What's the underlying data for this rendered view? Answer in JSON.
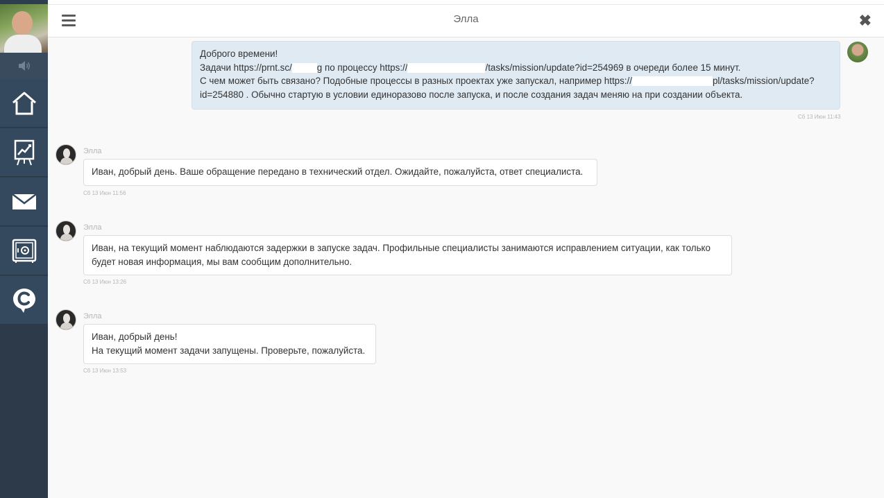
{
  "header": {
    "title": "Элла",
    "menu_icon": "hamburger-icon",
    "close_icon": "close-icon",
    "close_glyph": "✖"
  },
  "sidebar": {
    "items": [
      {
        "icon": "sound-icon"
      },
      {
        "icon": "home-icon"
      },
      {
        "icon": "chart-board-icon"
      },
      {
        "icon": "mail-icon"
      },
      {
        "icon": "safe-icon"
      },
      {
        "icon": "chat-logo-icon"
      }
    ],
    "colors": {
      "background": "#2f3e4e",
      "item": "#34495e"
    }
  },
  "messages": [
    {
      "direction": "out",
      "lines": [
        "Доброго времени!",
        "Задачи https://prnt.sc/",
        "g по процессу https://",
        "/tasks/mission/update?id=254969 в очереди более 15 минут.",
        "С чем может быть связано? Подобные процессы в разных проектах уже запускал, например https://",
        "pl/tasks/mission/update?",
        "id=254880 . Обычно стартую в условии единоразово после запуска, и после создания задач меняю на при создании объекта."
      ],
      "time": "Сб 13 Июн 11:43"
    },
    {
      "direction": "in",
      "sender": "Элла",
      "lines": [
        "Иван, добрый день. Ваше обращение передано в технический отдел. Ожидайте, пожалуйста, ответ специалиста."
      ],
      "time": "Сб 13 Июн 11:56"
    },
    {
      "direction": "in",
      "sender": "Элла",
      "lines": [
        "Иван, на текущий момент наблюдаются задержки в запуске задач. Профильные специалисты занимаются исправлением ситуации, как только",
        "будет новая информация, мы вам сообщим дополнительно."
      ],
      "time": "Сб 13 Июн 13:26"
    },
    {
      "direction": "in",
      "sender": "Элла",
      "lines": [
        "Иван, добрый день!",
        "На текущий момент задачи запущены. Проверьте, пожалуйста."
      ],
      "time": "Сб 13 Июн 13:53"
    }
  ],
  "colors": {
    "outgoing_bubble": "#dfeaf3",
    "incoming_bubble": "#ffffff",
    "chat_background": "#f9f9f9"
  }
}
